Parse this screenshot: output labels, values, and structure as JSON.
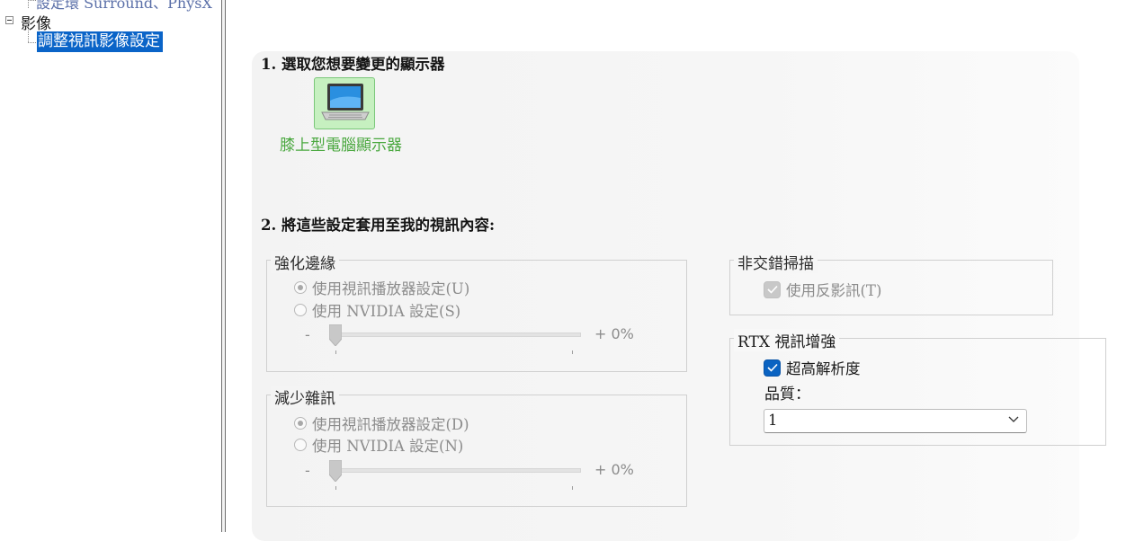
{
  "tree": {
    "cut_item": "設定環 Surround、PhysX",
    "parent": "影像",
    "selected": "調整視訊影像設定"
  },
  "step1": {
    "title": "1. 選取您想要變更的顯示器",
    "display_label": "膝上型電腦顯示器"
  },
  "step2": {
    "title": "2. 將這些設定套用至我的視訊內容:"
  },
  "edge_enhance": {
    "title": "強化邊緣",
    "option_player": "使用視訊播放器設定(U)",
    "option_nvidia": "使用 NVIDIA 設定(S)",
    "minus": "-",
    "plus": "+ 0%",
    "selected": "player",
    "slider_value_percent": 0
  },
  "noise_reduction": {
    "title": "減少雜訊",
    "option_player": "使用視訊播放器設定(D)",
    "option_nvidia": "使用 NVIDIA 設定(N)",
    "minus": "-",
    "plus": "+ 0%",
    "selected": "player",
    "slider_value_percent": 0
  },
  "deinterlace": {
    "title": "非交錯掃描",
    "inverse_telecine": "使用反影訊(T)",
    "inverse_telecine_checked": true
  },
  "rtx": {
    "title": "RTX 視訊增強",
    "super_resolution": "超高解析度",
    "super_resolution_checked": true,
    "quality_label": "品質：",
    "quality_value": "1"
  },
  "colors": {
    "selection": "#0a64c8",
    "display_bg": "#c6f0c0",
    "display_text": "#4aa83f",
    "checkbox_blue": "#0a63c2"
  }
}
